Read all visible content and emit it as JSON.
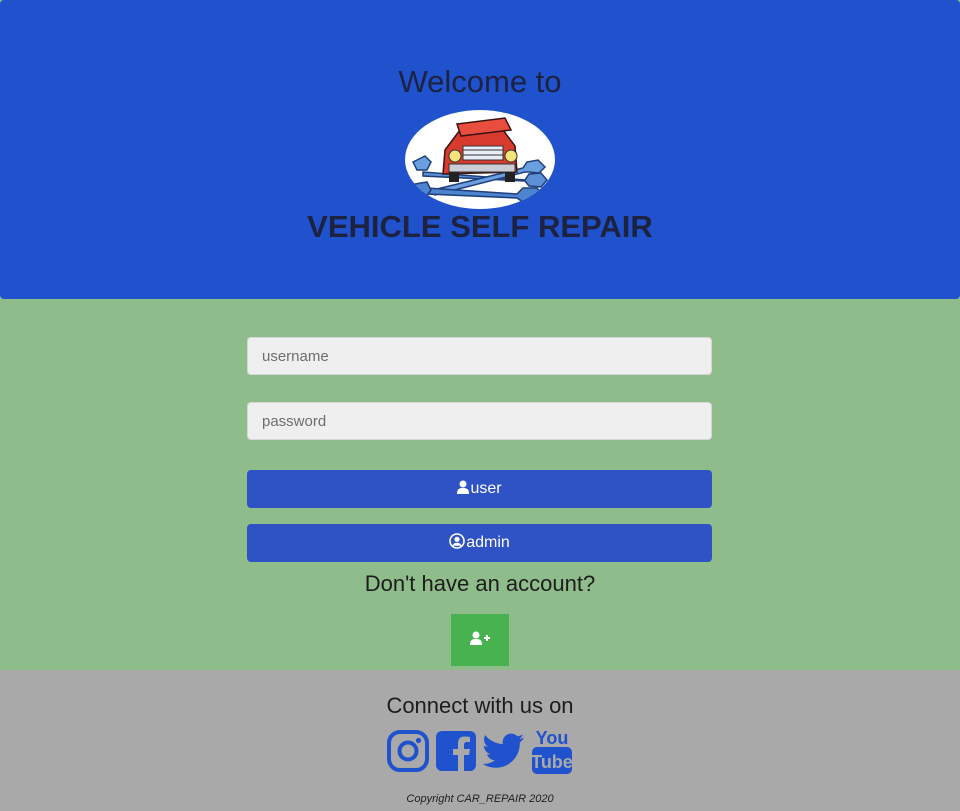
{
  "header": {
    "welcome": "Welcome to",
    "brand": "VEHICLE SELF REPAIR"
  },
  "login": {
    "username_placeholder": "username",
    "password_placeholder": "password",
    "user_label": "user",
    "admin_label": "admin",
    "no_account": "Don't have an account?"
  },
  "footer": {
    "connect": "Connect with us on",
    "copyright": "Copyright CAR_REPAIR 2020",
    "social": [
      "instagram-icon",
      "facebook-icon",
      "twitter-icon",
      "youtube-icon"
    ]
  },
  "colors": {
    "header_bg": "#1f52cc",
    "main_bg": "#8fbc8b",
    "button_bg": "#2f52c4",
    "signup_bg": "#48b24f",
    "footer_bg": "#a9a9a9",
    "social_icon": "#1f52cc"
  }
}
